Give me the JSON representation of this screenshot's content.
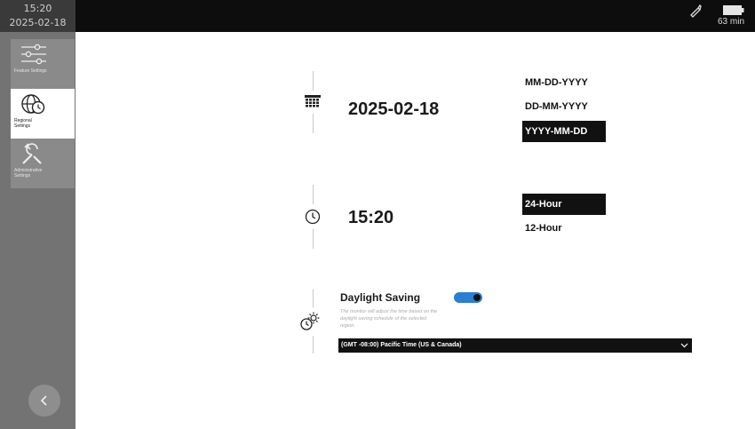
{
  "status_bar": {
    "time": "15:20",
    "date": "2025-02-18",
    "battery_text": "63 min",
    "icons": [
      "probe-icon",
      "battery-icon"
    ]
  },
  "sidebar": {
    "items": [
      {
        "label": "Feature Settings",
        "icon": "sliders-icon",
        "active": false
      },
      {
        "label": "Regional Settings",
        "icon": "globe-clock-icon",
        "active": true
      },
      {
        "label": "Administrative Settings",
        "icon": "tools-icon",
        "active": false
      }
    ],
    "back_icon": "chevron-left-icon"
  },
  "date_section": {
    "icon": "calendar-icon",
    "value": "2025-02-18",
    "formats": [
      "MM-DD-YYYY",
      "DD-MM-YYYY",
      "YYYY-MM-DD"
    ],
    "selected_format": "YYYY-MM-DD"
  },
  "time_section": {
    "icon": "clock-icon",
    "value": "15:20",
    "formats": [
      "24-Hour",
      "12-Hour"
    ],
    "selected_format": "24-Hour"
  },
  "daylight_saving": {
    "icon": "daylight-saving-icon",
    "title": "Daylight Saving",
    "description": "The monitor will adjust the time based on the daylight saving schedule of the selected region.",
    "enabled": true,
    "toggle_color": "#2a7fd4",
    "timezone": "(GMT -08:00) Pacific Time (US & Canada)"
  },
  "colors": {
    "topbar": "#0d0d0d",
    "sidebar": "#737373",
    "selected_option": "#111111"
  }
}
